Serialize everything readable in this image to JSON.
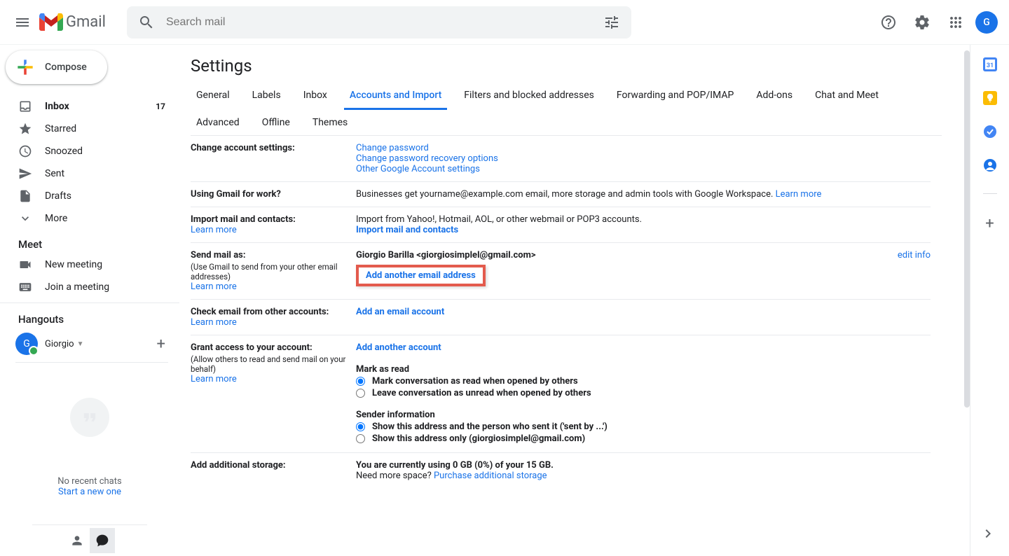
{
  "header": {
    "product_name": "Gmail",
    "search_placeholder": "Search mail",
    "avatar_initial": "G"
  },
  "compose_label": "Compose",
  "nav": {
    "inbox": "Inbox",
    "inbox_count": "17",
    "starred": "Starred",
    "snoozed": "Snoozed",
    "sent": "Sent",
    "drafts": "Drafts",
    "more": "More"
  },
  "meet": {
    "title": "Meet",
    "new_meeting": "New meeting",
    "join_meeting": "Join a meeting"
  },
  "hangouts": {
    "title": "Hangouts",
    "user_initial": "G",
    "user_name": "Giorgio",
    "no_recent": "No recent chats",
    "start_new": "Start a new one"
  },
  "page_title": "Settings",
  "tabs": {
    "general": "General",
    "labels": "Labels",
    "inbox": "Inbox",
    "accounts": "Accounts and Import",
    "filters": "Filters and blocked addresses",
    "forwarding": "Forwarding and POP/IMAP",
    "addons": "Add-ons",
    "chat": "Chat and Meet",
    "advanced": "Advanced",
    "offline": "Offline",
    "themes": "Themes"
  },
  "sections": {
    "change_account": {
      "title": "Change account settings:",
      "change_password": "Change password",
      "change_recovery": "Change password recovery options",
      "other_settings": "Other Google Account settings"
    },
    "using_for_work": {
      "title": "Using Gmail for work?",
      "body": "Businesses get yourname@example.com email, more storage and admin tools with Google Workspace. ",
      "learn_more": "Learn more"
    },
    "import_mail": {
      "title": "Import mail and contacts:",
      "learn_more": "Learn more",
      "body": "Import from Yahoo!, Hotmail, AOL, or other webmail or POP3 accounts.",
      "action": "Import mail and contacts"
    },
    "send_as": {
      "title": "Send mail as:",
      "sub": "(Use Gmail to send from your other email addresses)",
      "learn_more": "Learn more",
      "identity": "Giorgio Barilla <giorgiosimplel@gmail.com>",
      "add_another": "Add another email address",
      "edit_info": "edit info"
    },
    "check_other": {
      "title": "Check email from other accounts:",
      "learn_more": "Learn more",
      "action": "Add an email account"
    },
    "grant_access": {
      "title": "Grant access to your account:",
      "sub": "(Allow others to read and send mail on your behalf)",
      "learn_more": "Learn more",
      "action": "Add another account",
      "mark_as_read": "Mark as read",
      "opt1": "Mark conversation as read when opened by others",
      "opt2": "Leave conversation as unread when opened by others",
      "sender_info": "Sender information",
      "opt3": "Show this address and the person who sent it ('sent by ...')",
      "opt4": "Show this address only (giorgiosimplel@gmail.com)"
    },
    "storage": {
      "title": "Add additional storage:",
      "body": "You are currently using 0 GB (0%) of your 15 GB.",
      "need_more": "Need more space? ",
      "purchase": "Purchase additional storage"
    }
  }
}
